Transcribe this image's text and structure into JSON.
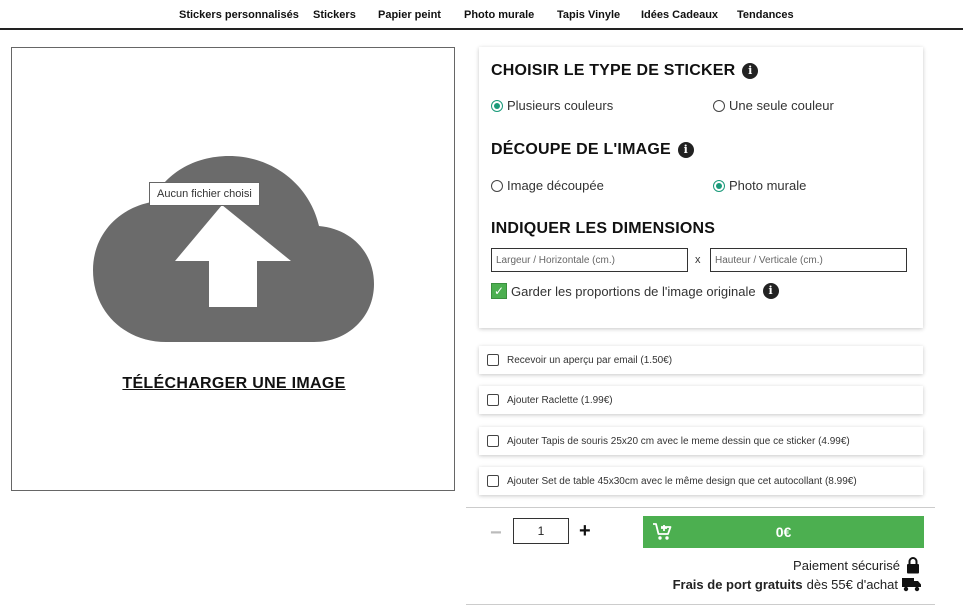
{
  "nav": {
    "items": [
      "Stickers personnalisés",
      "Stickers",
      "Papier peint",
      "Photo murale",
      "Tapis Vinyle",
      "Idées Cadeaux",
      "Tendances"
    ]
  },
  "upload": {
    "file_status": "Aucun fichier choisi",
    "title": "TÉLÉCHARGER UNE IMAGE",
    "icon": "cloud-upload-icon"
  },
  "sticker_type": {
    "title": "CHOISIR LE TYPE DE STICKER",
    "options": [
      "Plusieurs couleurs",
      "Une seule couleur"
    ],
    "selected": "Plusieurs couleurs"
  },
  "cut": {
    "title": "DÉCOUPE DE L'IMAGE",
    "options": [
      "Image découpée",
      "Photo murale"
    ],
    "selected": "Photo murale"
  },
  "dimensions": {
    "title": "INDIQUER LES DIMENSIONS",
    "width_placeholder": "Largeur / Horizontale (cm.)",
    "height_placeholder": "Hauteur / Verticale (cm.)",
    "separator": "x",
    "keep_ratio_label": "Garder les proportions de l'image originale",
    "keep_ratio_checked": true
  },
  "addons": [
    "Recevoir un aperçu par email (1.50€)",
    "Ajouter Raclette (1.99€)",
    "Ajouter Tapis de souris 25x20 cm avec le meme dessin que ce sticker (4.99€)",
    "Ajouter Set de table 45x30cm avec le même design que cet autocollant (8.99€)"
  ],
  "purchase": {
    "minus": "−",
    "quantity": "1",
    "plus": "+",
    "price": "0€",
    "secure_label": "Paiement sécurisé",
    "shipping_bold": "Frais de port gratuits",
    "shipping_rest": "dès 55€ d'achat"
  },
  "colors": {
    "accent_green": "#4caf50",
    "radio_teal": "#1a9a7a",
    "cloud_gray": "#6b6b6b"
  }
}
